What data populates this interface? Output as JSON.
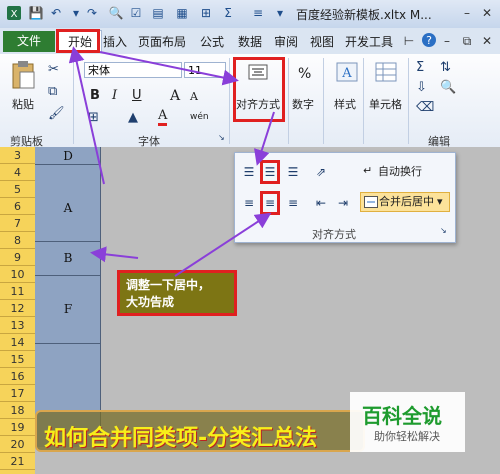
{
  "window": {
    "title": "百度经验新模板.xltx M..."
  },
  "tabs": [
    "文件",
    "开始",
    "插入",
    "页面布局",
    "公式",
    "数据",
    "审阅",
    "视图",
    "开发工具"
  ],
  "ribbon": {
    "paste_label": "粘贴",
    "clipboard_label": "剪贴板",
    "font_name": "宋体",
    "font_size": "11",
    "font_label": "字体",
    "align_button_label": "对齐方式",
    "number_label": "数字",
    "number_symbol": "%",
    "style_label": "样式",
    "cells_label": "单元格",
    "edit_label": "编辑",
    "bold": "B",
    "italic": "I",
    "underline": "U",
    "grow_font": "A",
    "shrink_font": "A",
    "font_color": "A",
    "font_extra": "wén"
  },
  "sheet": {
    "rows": [
      "3",
      "4",
      "5",
      "6",
      "7",
      "8",
      "9",
      "10",
      "11",
      "12",
      "13",
      "14",
      "15",
      "16",
      "17",
      "18",
      "19",
      "20",
      "21"
    ],
    "cells": {
      "d": "D",
      "a": "A",
      "b": "B",
      "f": "F"
    }
  },
  "popup": {
    "wrap_text": "自动换行",
    "merge_center": "合并后居中",
    "group_label": "对齐方式"
  },
  "callout": {
    "line1": "调整一下居中，",
    "line2": "大功告成"
  },
  "banner": {
    "text": "如何合并同类项-分类汇总法"
  },
  "watermark": {
    "title": "百科全说",
    "subtitle": "助你轻松解决"
  },
  "colors": {
    "accent_red": "#e02020",
    "file_tab": "#2e7d32",
    "arrow": "#8a3fd9",
    "selection": "#8ea3c2",
    "row_header": "#f6d35a"
  }
}
